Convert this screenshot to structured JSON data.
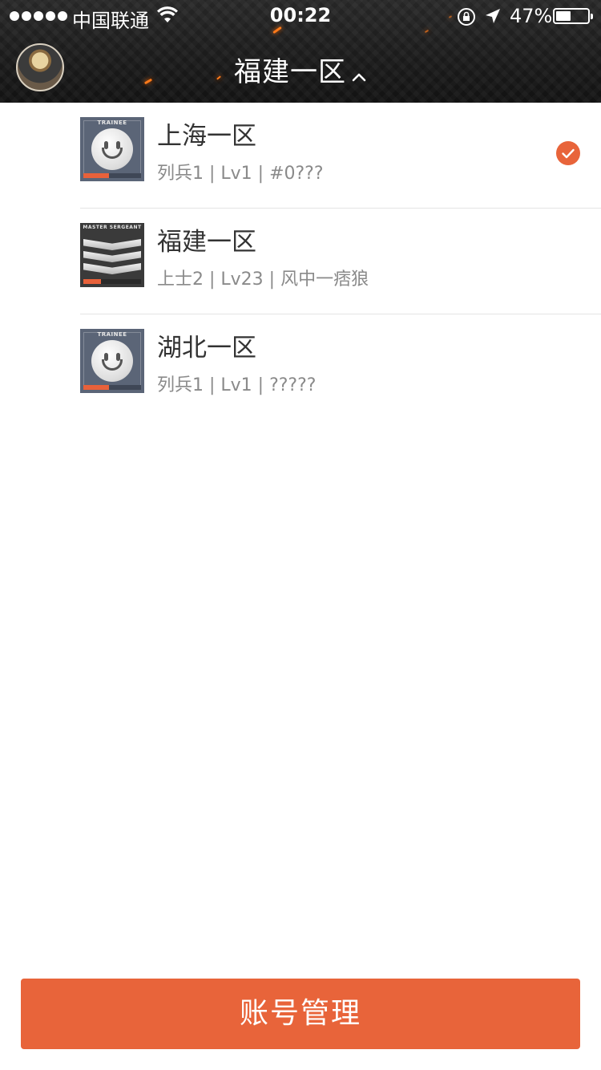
{
  "status_bar": {
    "carrier": "中国联通",
    "time": "00:22",
    "battery_percent": "47%",
    "battery_level": 0.47
  },
  "nav": {
    "title": "福建一区"
  },
  "servers": [
    {
      "name": "上海一区",
      "sub": "列兵1 | Lv1 | #0???",
      "rank_badge": "TRAINEE",
      "progress": 0.45,
      "selected": false
    },
    {
      "name": "福建一区",
      "sub": "上士2 | Lv23 | 风中一痞狼",
      "rank_badge": "MASTER SERGEANT",
      "progress": 0.3,
      "selected": true
    },
    {
      "name": "湖北一区",
      "sub": "列兵1 | Lv1 | ?????",
      "rank_badge": "TRAINEE",
      "progress": 0.45,
      "selected": false
    }
  ],
  "footer": {
    "account_button": "账号管理"
  },
  "colors": {
    "accent": "#e8643a",
    "header_bg": "#1c1c1c"
  }
}
